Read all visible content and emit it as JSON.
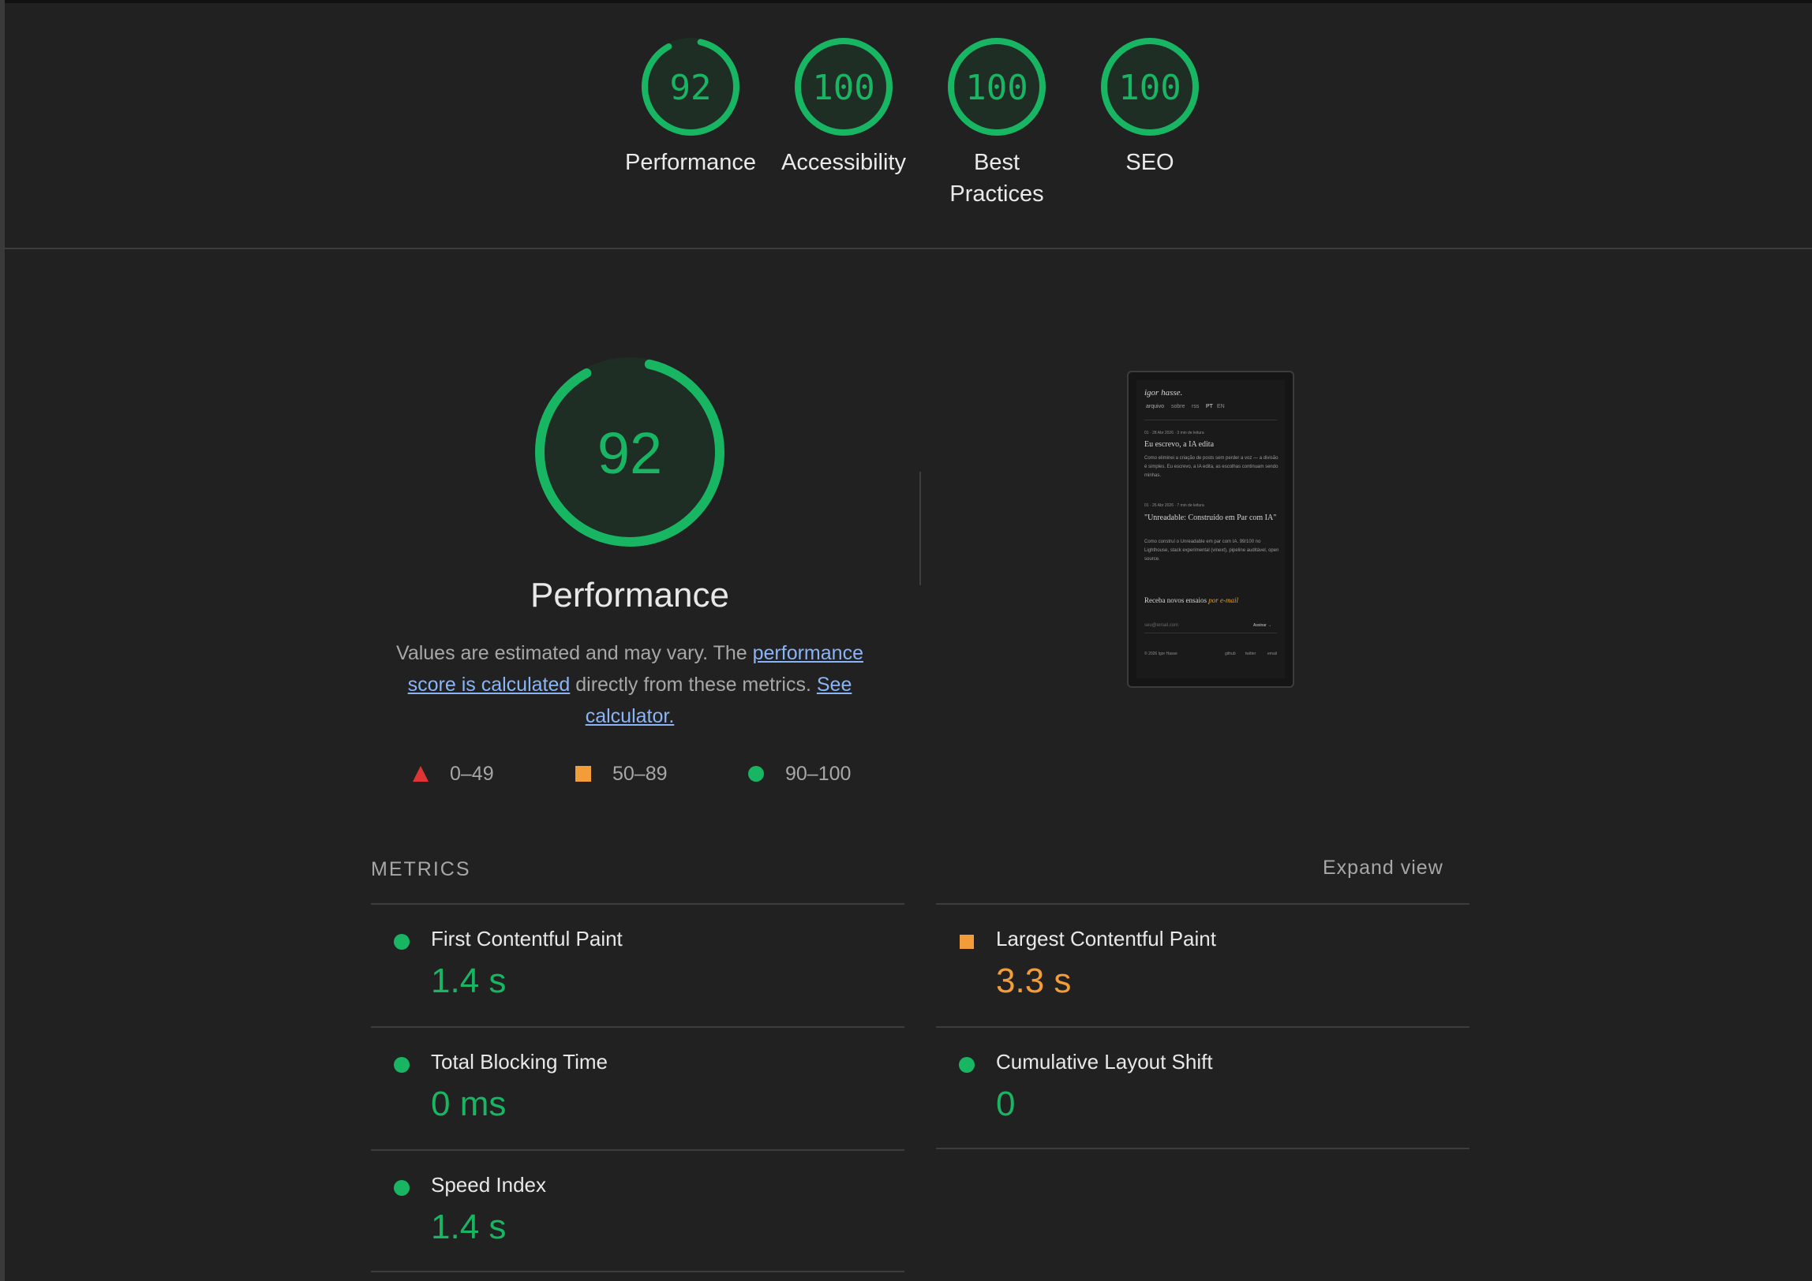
{
  "summary": {
    "gauges": [
      {
        "score": 92,
        "label": "Performance",
        "fraction": 0.92
      },
      {
        "score": 100,
        "label": "Accessibility",
        "fraction": 1.0
      },
      {
        "score": 100,
        "label": "Best Practices",
        "fraction": 1.0
      },
      {
        "score": 100,
        "label": "SEO",
        "fraction": 1.0
      }
    ]
  },
  "performance": {
    "score": 92,
    "fraction": 0.92,
    "title": "Performance",
    "desc_prefix": "Values are estimated and may vary. The ",
    "desc_link1": "performance score is calculated",
    "desc_mid": " directly from these metrics. ",
    "desc_link2": "See calculator.",
    "legend": [
      {
        "range": "0–49",
        "shape": "triangle",
        "color": "#e03535"
      },
      {
        "range": "50–89",
        "shape": "square",
        "color": "#f29d3a"
      },
      {
        "range": "90–100",
        "shape": "circle",
        "color": "#18b663"
      }
    ]
  },
  "thumbnail": {
    "site_name": "igor hasse.",
    "nav": [
      "arquivo",
      "sobre",
      "rss",
      "PT",
      "EN"
    ],
    "post1_meta": "01  ·  28 Abr 2026  ·  3 min de leitura",
    "post1_title": "Eu escrevo, a IA edita",
    "post1_excerpt": "Como eliminei a criação de posts sem perder a voz — a divisão é simples. Eu escrevo, a IA edita, as escolhas continuam sendo minhas.",
    "post2_meta": "01  ·  26 Abr 2026  ·  7 min de leitura",
    "post2_title": "\"Unreadable: Construído em Par com IA\"",
    "post2_excerpt": "Como construí o Unreadable em par com IA. 99/100 no Lighthouse, stack experimental (vinext), pipeline auditável, open source.",
    "newsletter_text": "Receba novos ensaios ",
    "newsletter_em": "por e-mail",
    "email_placeholder": "seu@email.com",
    "subscribe": "Assinar →",
    "footer_copy": "© 2026 Igor Hasse",
    "footer_links": [
      "github",
      "twitter",
      "email"
    ]
  },
  "metrics": {
    "heading": "METRICS",
    "expand": "Expand view",
    "items": [
      {
        "name": "First Contentful Paint",
        "value": "1.4 s",
        "status": "good"
      },
      {
        "name": "Largest Contentful Paint",
        "value": "3.3 s",
        "status": "average"
      },
      {
        "name": "Total Blocking Time",
        "value": "0 ms",
        "status": "good"
      },
      {
        "name": "Cumulative Layout Shift",
        "value": "0",
        "status": "good"
      },
      {
        "name": "Speed Index",
        "value": "1.4 s",
        "status": "good"
      }
    ]
  },
  "colors": {
    "good": "#18b663",
    "average": "#f29d3a",
    "poor": "#e03535",
    "gauge_bg": "#1f2e25"
  }
}
